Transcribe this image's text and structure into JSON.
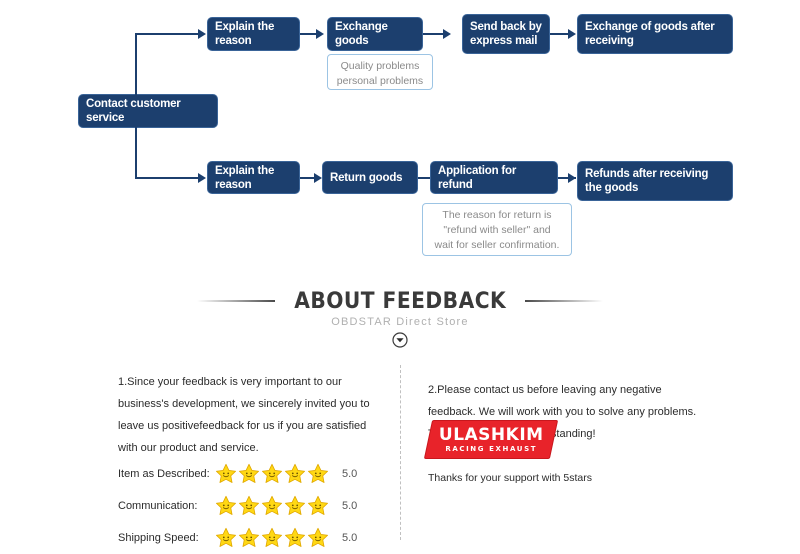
{
  "colors": {
    "node_fill": "#1c3f6e",
    "node_border": "#3a6498",
    "callout_border": "#9cc4e4",
    "callout_text": "#8a8a8a",
    "brand_red": "#e8232a",
    "star_yellow": "#ffd814"
  },
  "flowchart": {
    "root": {
      "label": "Contact customer service"
    },
    "branches": [
      {
        "name": "exchange-branch",
        "steps": [
          {
            "label": "Explain the reason"
          },
          {
            "label": "Exchange goods"
          },
          {
            "label": "Send back by express mail"
          },
          {
            "label": "Exchange of goods after receiving"
          }
        ],
        "callout": "Quality problems\npersonal problems"
      },
      {
        "name": "refund-branch",
        "steps": [
          {
            "label": "Explain the reason"
          },
          {
            "label": "Return goods"
          },
          {
            "label": "Application for refund"
          },
          {
            "label": "Refunds after receiving the goods"
          }
        ],
        "callout": "The reason for return is\n\"refund with seller\" and\nwait for seller confirmation."
      }
    ],
    "node_labels": {
      "explain_1": "Explain the reason",
      "exchange_goods": "Exchange goods",
      "send_back": "Send back by express mail",
      "exchange_receive": "Exchange of goods after receiving",
      "explain_2": "Explain the reason",
      "return_goods": "Return goods",
      "application_refund": "Application for refund",
      "refunds_receive": "Refunds after receiving the goods"
    },
    "callout_top_line1": "Quality problems",
    "callout_top_line2": "personal problems",
    "callout_bottom_line1": "The reason for return is",
    "callout_bottom_line2": "\"refund with seller\" and",
    "callout_bottom_line3": "wait for seller confirmation."
  },
  "feedback_header": {
    "title": "ABOUT FEEDBACK",
    "subtitle": "OBDSTAR Direct Store",
    "chevron_icon": "chevron-down-circle-icon"
  },
  "feedback": {
    "paragraph_left": "1.Since your feedback is very important to our business's development, we sincerely invited you to leave us positivefeedback for us if you are satisfied with our product and service.",
    "paragraph_right": "2.Please contact us before leaving any negative feedback. We will work with you to solve any problems. Thank you for your understanding!",
    "ratings": [
      {
        "label": "Item as Described:",
        "stars": 5,
        "score": "5.0"
      },
      {
        "label": "Communication:",
        "stars": 5,
        "score": "5.0"
      },
      {
        "label": "Shipping Speed:",
        "stars": 5,
        "score": "5.0"
      }
    ]
  },
  "brand": {
    "name": "ULASHKIM",
    "tagline": "RACING EXHAUST",
    "note": "Thanks for your support with 5stars"
  }
}
